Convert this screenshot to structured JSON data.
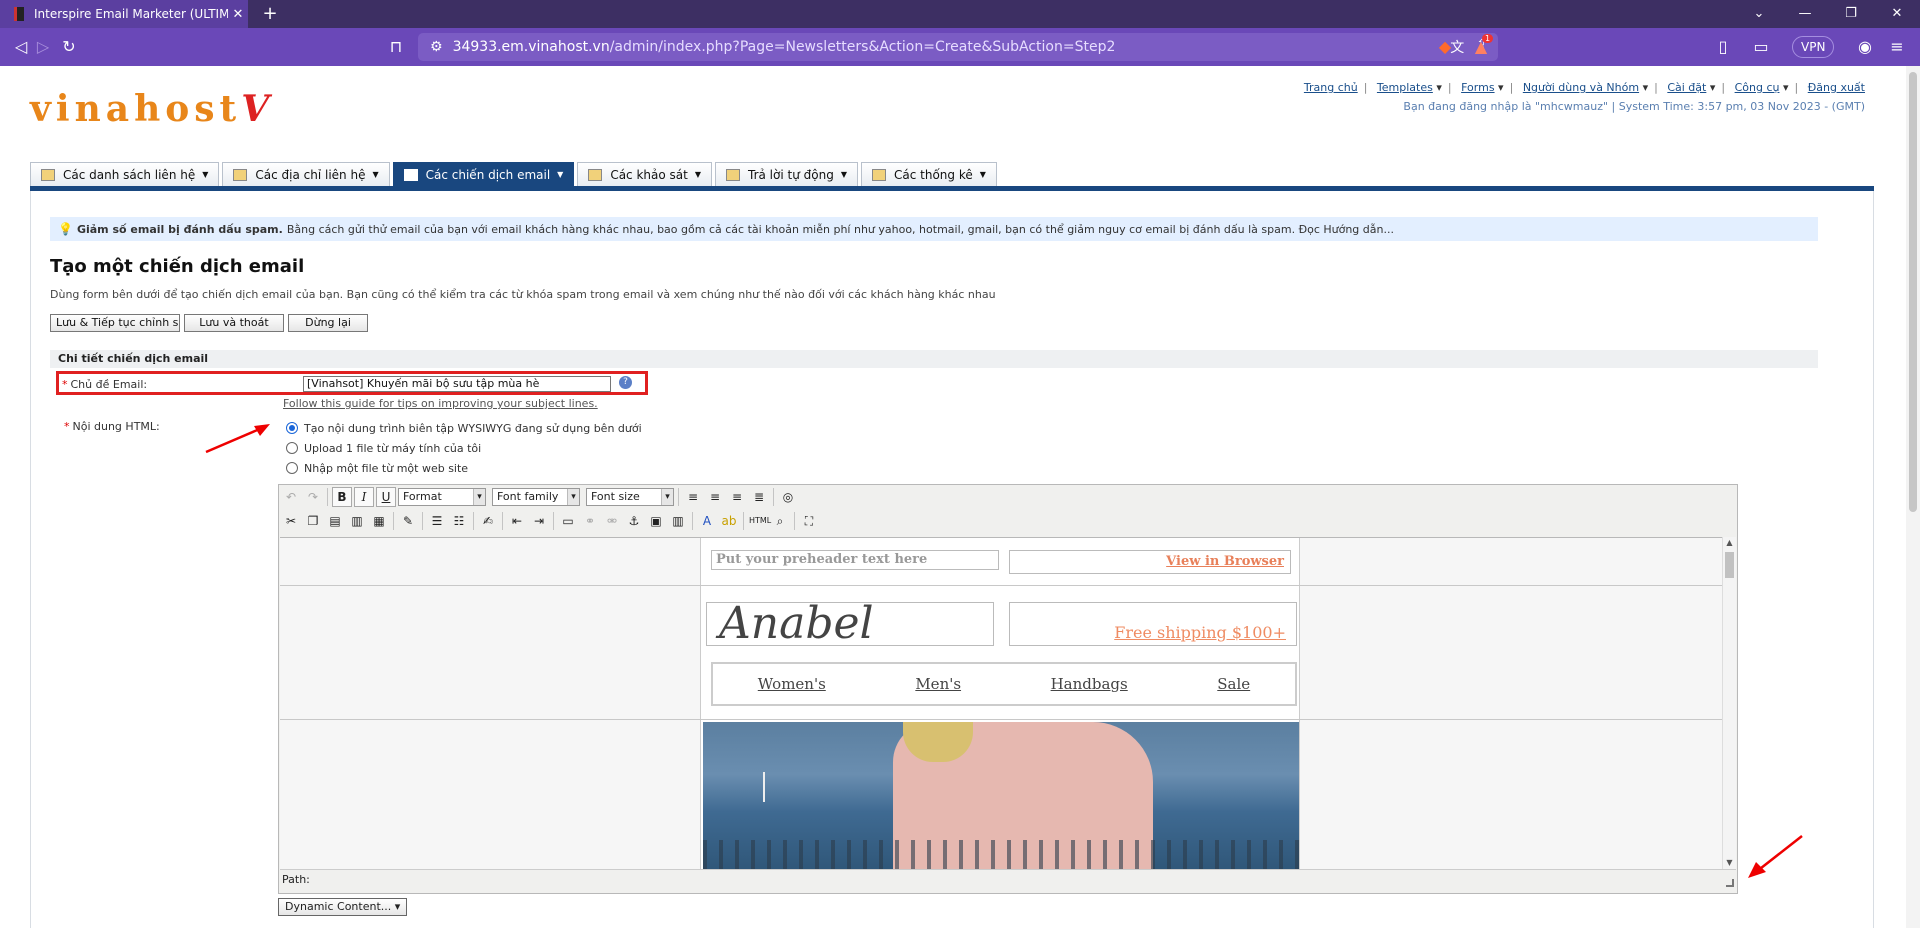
{
  "browser": {
    "tab_title": "Interspire Email Marketer (ULTIM",
    "tab_close": "✕",
    "new_tab": "+",
    "url_host": "34933.em.vinahost.vn",
    "url_path": "/admin/index.php?Page=Newsletters&Action=Create&SubAction=Step2",
    "vpn_label": "VPN",
    "badge_count": "1"
  },
  "header": {
    "logo_text": "vinahost",
    "logo_mark": "V",
    "links": [
      "Trang chủ",
      "Templates",
      "Forms",
      "Người dùng và Nhóm",
      "Cài đặt",
      "Công cụ",
      "Đăng xuất"
    ],
    "login_info": "Bạn đang đăng nhập là \"mhcwmauz\" | System Time: 3:57 pm, 03 Nov 2023 - (GMT)"
  },
  "tabs": [
    {
      "label": "Các danh sách liên hệ",
      "icon": "contacts-list-icon"
    },
    {
      "label": "Các địa chỉ liên hệ",
      "icon": "contacts-icon"
    },
    {
      "label": "Các chiến dịch email",
      "icon": "email-campaign-icon",
      "active": true
    },
    {
      "label": "Các khảo sát",
      "icon": "survey-icon"
    },
    {
      "label": "Trả lời tự động",
      "icon": "autoresponder-icon"
    },
    {
      "label": "Các thống kê",
      "icon": "stats-icon"
    }
  ],
  "tip": {
    "bold": "Giảm số email bị đánh dấu spam.",
    "text": "Bằng cách gửi thử email của bạn với email khách hàng khác nhau, bao gồm cả các tài khoản miễn phí như yahoo, hotmail, gmail, bạn có thể giảm nguy cơ email bị đánh dấu là spam. Đọc Hướng dẫn..."
  },
  "page": {
    "title": "Tạo một chiến dịch email",
    "description": "Dùng form bên dưới để tạo chiến dịch email của bạn. Bạn cũng có thể kiểm tra các từ khóa spam trong email và xem chúng như thế nào đối với các khách hàng khác nhau",
    "buttons": {
      "save_continue": "Lưu & Tiếp tục chỉnh sửa",
      "save_exit": "Lưu và thoát",
      "cancel": "Dừng lại"
    },
    "section_title": "Chi tiết chiến dịch email"
  },
  "form": {
    "subject_label": "Chủ đề Email:",
    "subject_value": "[Vinahsot] Khuyến mãi bộ sưu tập mùa hè",
    "guide_link": "Follow this guide for tips on improving your subject lines.",
    "html_label": "Nội dung HTML:",
    "options": [
      "Tạo nội dung trình biên tập WYSIWYG đang sử dụng bên dưới",
      "Upload 1 file từ máy tính của tôi",
      "Nhập một file từ một web site"
    ],
    "selected_option": 0
  },
  "editor": {
    "format_label": "Format",
    "font_family_label": "Font family",
    "font_size_label": "Font size",
    "preheader": "Put your preheader text here",
    "view_in_browser": "View in Browser",
    "brand": "Anabel",
    "free_shipping": "Free shipping $100+",
    "menu": [
      "Women's",
      "Men's",
      "Handbags",
      "Sale"
    ],
    "path_label": "Path:"
  },
  "dynamic_content_label": "Dynamic Content..."
}
